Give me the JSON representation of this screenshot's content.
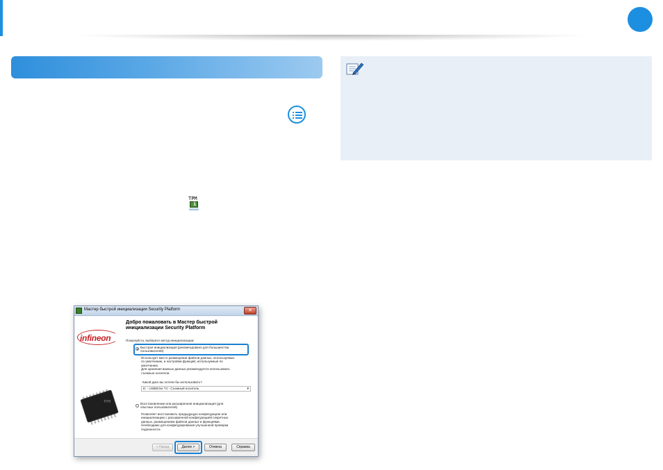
{
  "colors": {
    "accent": "#1c8fe0",
    "note_bg": "#e8eff7",
    "highlight": "#1a7fd0"
  },
  "icons": [
    "menu-list-icon",
    "tpm-tray-icon",
    "note-pen-icon"
  ],
  "tpm_icon": {
    "label": "TPM",
    "badge": "i"
  },
  "dialog": {
    "title": "Мастер быстрой инициализации Security Platform",
    "close_glyph": "✕",
    "logo": "infineon",
    "chip_label": "TPM",
    "heading_line1": "Добро пожаловать в Мастер быстрой",
    "heading_line2": "инициализации Security Platform",
    "prompt": "Пожалуйста, выберите метод инициализации:",
    "option1": {
      "label_line1": "Быстрая инициализация (рекомендовано для большинства",
      "label_line2": "пользователей)",
      "desc_line1": "Использует место размещения файлов данных, используемых",
      "desc_line2": "по умолчанию, и настройки функций, используемые по",
      "desc_line3": "умолчанию.",
      "desc_line4": "Для хранения важных данных рекомендуется использовать",
      "desc_line5": "съемные носители."
    },
    "disk_question": "Какой диск вы хотели бы использовать?",
    "disk_value": "E: - USBDrive T4 - Съемный носитель",
    "option2": {
      "label_line1": "Восстановление или расширенная инициализация (для",
      "label_line2": "опытных пользователей)",
      "desc_line1": "Позволяет восстановить предыдущую конфигурацию или",
      "desc_line2": "инициализацию с расширенной конфигурацией секретных",
      "desc_line3": "данных, размещением файлов данных и функциями.",
      "desc_line4": "Необходимо для конфигурирования улучшенной проверки",
      "desc_line5": "подлинности."
    },
    "buttons": {
      "back": "< Назад",
      "next": "Далее >",
      "cancel": "Отмена",
      "help": "Справка"
    }
  }
}
